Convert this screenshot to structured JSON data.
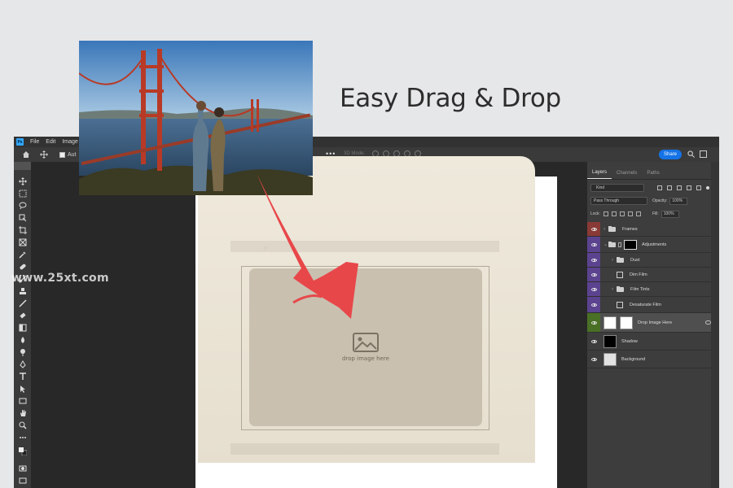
{
  "headline": "Easy Drag & Drop",
  "watermark": "www.25xt.com",
  "app": {
    "logo": "Ps",
    "menu": [
      "File",
      "Edit",
      "Image"
    ],
    "options": {
      "auto_label": "Aut",
      "mode_label": "3D Mode:",
      "share_label": "Share"
    }
  },
  "dropzone": {
    "text": "drop image here",
    "icon": "image-placeholder-icon"
  },
  "panel": {
    "tabs": [
      "Layers",
      "Channels",
      "Paths"
    ],
    "active_tab": "Layers",
    "kind": "Kind",
    "blend_mode": "Pass Through",
    "opacity_label": "Opacity:",
    "opacity_value": "100%",
    "lock_label": "Lock:",
    "fill_label": "Fill:",
    "fill_value": "100%",
    "layers": [
      {
        "name": "Frames",
        "type": "group",
        "tag": "#c0392b",
        "collapsed": true
      },
      {
        "name": "Adjustments",
        "type": "group-mask",
        "tag": "#7b4fb8"
      },
      {
        "name": "Dust",
        "type": "group",
        "tag": "#7b4fb8",
        "indent": true
      },
      {
        "name": "Dim Film",
        "type": "adjustment",
        "tag": "#7b4fb8",
        "indent": true
      },
      {
        "name": "Film Tints",
        "type": "group",
        "tag": "#7b4fb8",
        "indent": true
      },
      {
        "name": "Desaturate Film",
        "type": "adjustment",
        "tag": "#7b4fb8",
        "indent": true
      },
      {
        "name": "Drop Image Here",
        "type": "smart-object",
        "tag": "#5d8a2e",
        "selected": true
      },
      {
        "name": "Shadow",
        "type": "pixel-black",
        "tag": ""
      },
      {
        "name": "Background",
        "type": "pixel-light",
        "tag": ""
      }
    ]
  },
  "colors": {
    "ps_blue": "#31a8ff",
    "share_blue": "#1473e6",
    "arrow_red": "#e8474a"
  }
}
